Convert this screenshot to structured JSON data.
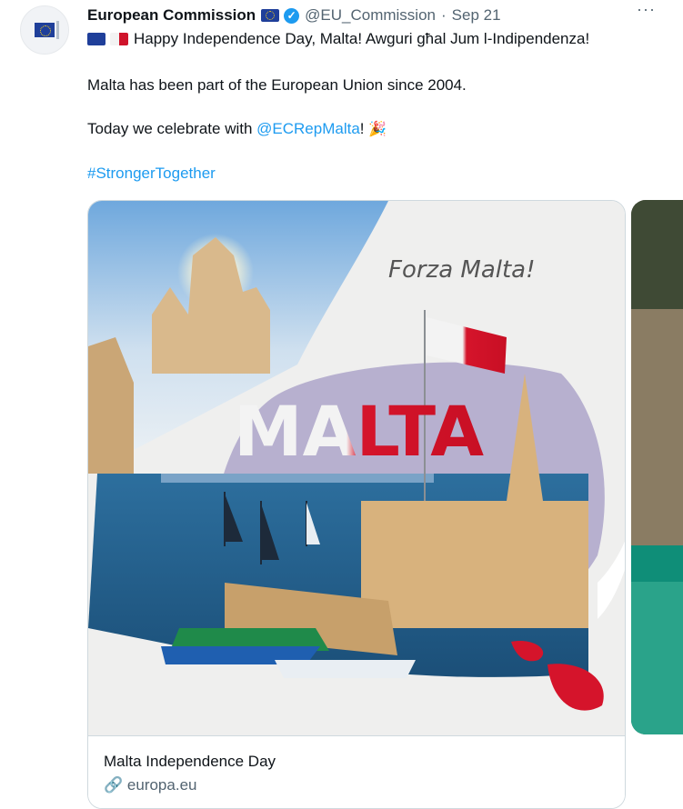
{
  "tweet": {
    "author_name": "European Commission",
    "handle": "@EU_Commission",
    "separator": "·",
    "date": "Sep 21",
    "more_label": "···",
    "line1": "Happy Independence Day, Malta! Awguri għal Jum l-Indipendenza!",
    "line2": "Malta has been part of the European Union since 2004.",
    "line3_prefix": "Today we celebrate with ",
    "line3_mention": "@ECRepMalta",
    "line3_suffix": "!",
    "hashtag": "#StrongerTogether"
  },
  "media": {
    "tagline": "Forza Malta!",
    "headline": "MALTA"
  },
  "card": {
    "title": "Malta Independence Day",
    "domain": "europa.eu"
  },
  "colors": {
    "accent": "#1d9bf0",
    "malta_red": "#cf142b",
    "eu_blue": "#1f3f9a"
  }
}
